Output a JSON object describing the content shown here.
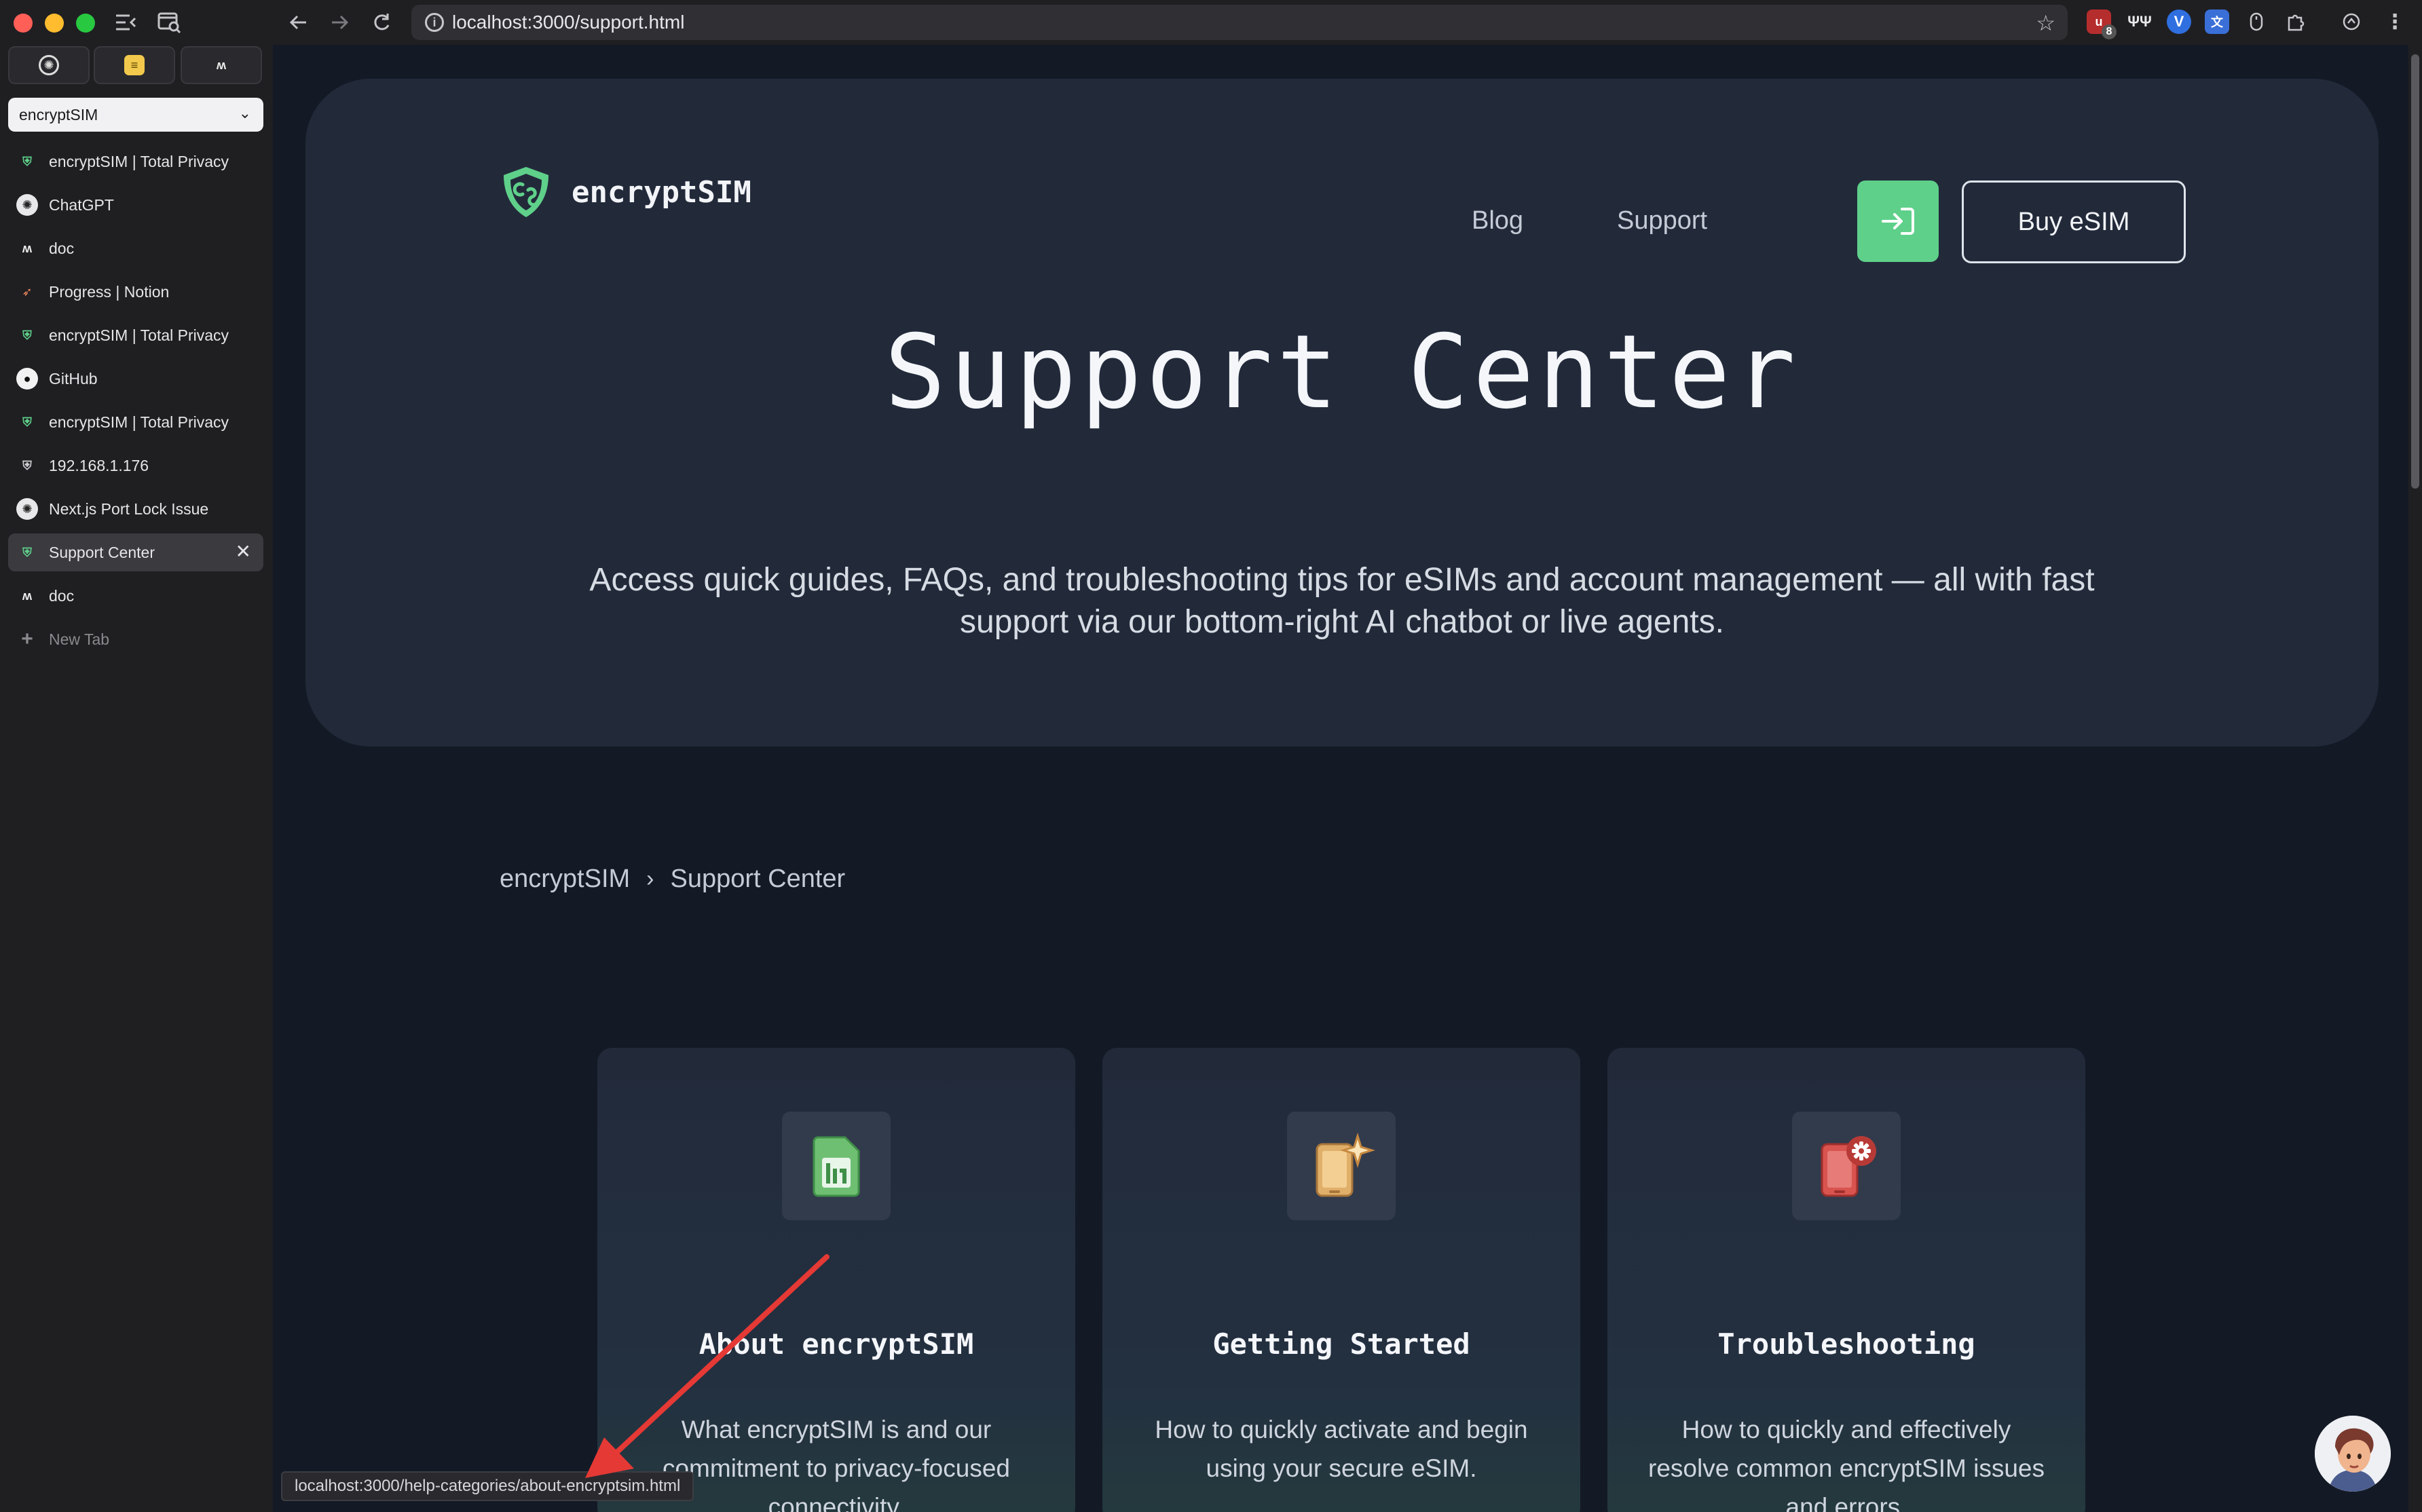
{
  "browser": {
    "url": "localhost:3000/support.html",
    "status_url": "localhost:3000/help-categories/about-encryptsim.html",
    "ext_badge": "8"
  },
  "sidebar": {
    "space_name": "encryptSIM",
    "tabs": [
      {
        "label": "encryptSIM | Total Privacy",
        "icon": "encryptsim-shield-icon"
      },
      {
        "label": "ChatGPT",
        "icon": "chatgpt-icon"
      },
      {
        "label": "doc",
        "icon": "doc-icon"
      },
      {
        "label": "Progress | Notion",
        "icon": "rocket-icon"
      },
      {
        "label": "encryptSIM | Total Privacy",
        "icon": "encryptsim-shield-icon"
      },
      {
        "label": "GitHub",
        "icon": "github-icon"
      },
      {
        "label": "encryptSIM | Total Privacy",
        "icon": "encryptsim-shield-icon"
      },
      {
        "label": "192.168.1.176",
        "icon": "shield-icon"
      },
      {
        "label": "Next.js Port Lock Issue",
        "icon": "chatgpt-icon"
      },
      {
        "label": "Support Center",
        "icon": "encryptsim-shield-icon",
        "active": true
      },
      {
        "label": "doc",
        "icon": "doc-icon"
      }
    ],
    "new_tab_label": "New Tab"
  },
  "header": {
    "brand": "encryptSIM",
    "nav": [
      "Blog",
      "Support"
    ],
    "buy_label": "Buy eSIM"
  },
  "hero": {
    "title": "Support Center",
    "subtitle": "Access quick guides, FAQs, and troubleshooting tips for eSIMs and account management — all with fast support via our bottom-right AI chatbot or live agents."
  },
  "breadcrumb": [
    "encryptSIM",
    "Support Center"
  ],
  "cards": [
    {
      "title": "About encryptSIM",
      "desc": "What encryptSIM is and our commitment to privacy-focused connectivity.",
      "icon": "sim-card-icon"
    },
    {
      "title": "Getting Started",
      "desc": "How to quickly activate and begin using your secure eSIM.",
      "icon": "phone-sparkle-icon"
    },
    {
      "title": "Troubleshooting",
      "desc": "How to quickly and effectively resolve common encryptSIM issues and errors.",
      "icon": "phone-gear-icon"
    }
  ],
  "colors": {
    "brand_green": "#5fd08a",
    "page_bg": "#131a26",
    "hero_bg": "#222a3a",
    "annotation_arrow": "#e53935"
  }
}
